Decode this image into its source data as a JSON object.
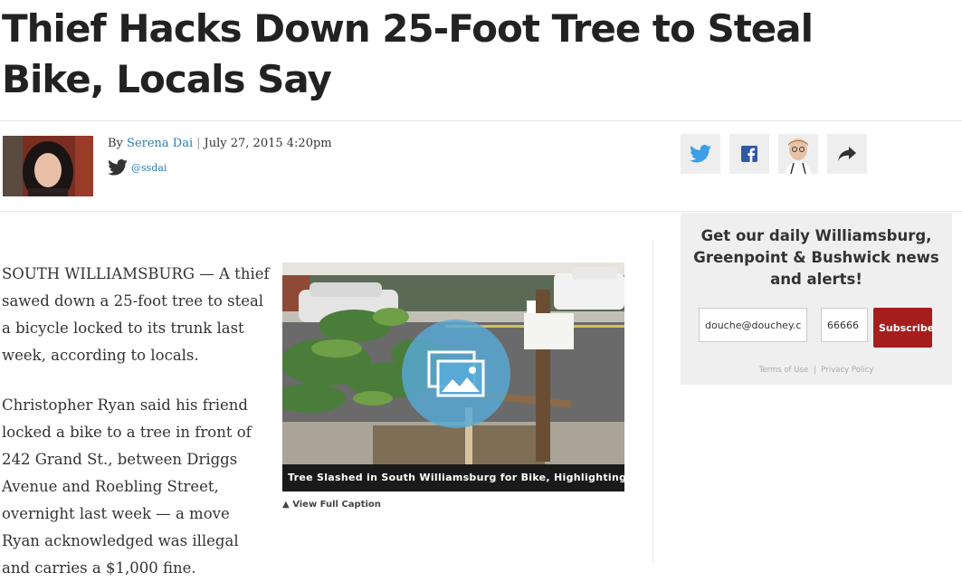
{
  "article": {
    "headline": "Thief Hacks Down 25-Foot Tree to Steal Bike, Locals Say",
    "byline_prefix": "By",
    "author": "Serena Dai",
    "date": "July 27, 2015 4:20pm",
    "twitter_handle": "@ssdai",
    "paragraph1": "SOUTH WILLIAMSBURG — A thief sawed down a 25-foot tree to steal a bicycle locked to its trunk last week, according to locals.",
    "paragraph2": "Christopher Ryan said his friend locked a bike to a tree in front of 242 Grand St., between Driggs Avenue and Roebling Street, overnight last week — a move Ryan acknowledged was illegal and carries a $1,000 fine."
  },
  "figure": {
    "caption": "Tree Slashed in South Williamsburg for Bike, Highlighting Need ...",
    "view_caption": "View Full Caption"
  },
  "share": {
    "icons": [
      "twitter-icon",
      "facebook-icon",
      "profile-avatar",
      "share-arrow-icon"
    ],
    "twitter_color": "#3b9ee6",
    "facebook_color": "#2f5aa6"
  },
  "signup": {
    "title": "Get our daily Williamsburg, Greenpoint & Bushwick news and alerts!",
    "email_value": "douche@douchey.com",
    "zip_value": "66666",
    "button_label": "Subscribe",
    "terms_label": "Terms of Use",
    "privacy_label": "Privacy Policy",
    "button_color": "#a61d1d"
  }
}
